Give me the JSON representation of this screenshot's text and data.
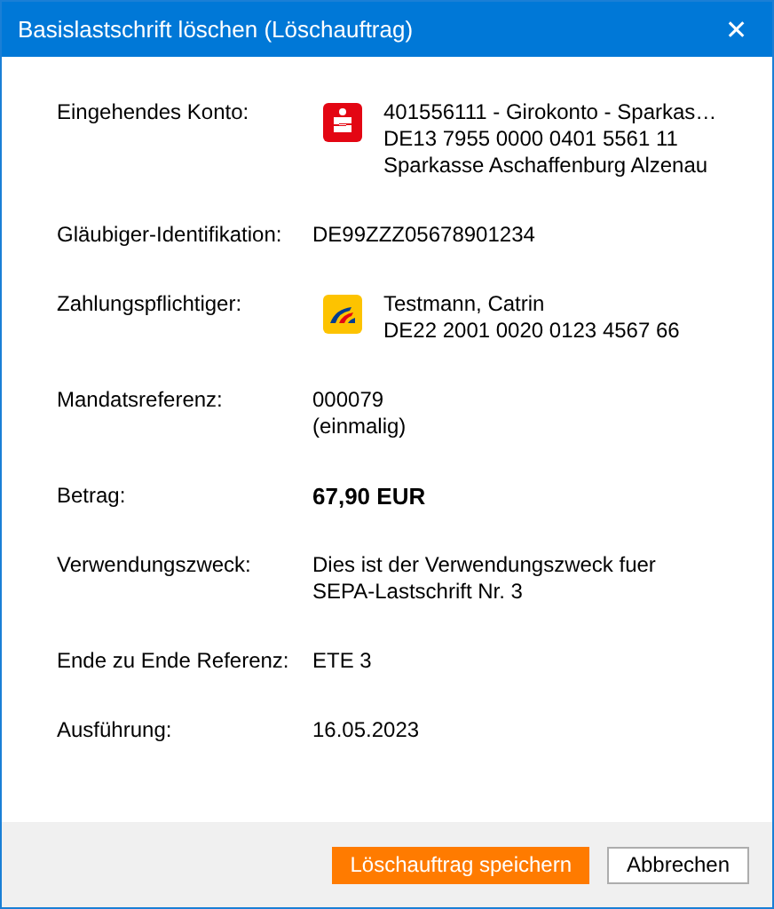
{
  "window": {
    "title": "Basislastschrift löschen (Löschauftrag)",
    "close": "✕"
  },
  "rows": [
    {
      "kind": "icon",
      "label": "Eingehendes Konto:",
      "lines": [
        "401556111 - Girokonto - Sparkas…",
        "DE13 7955 0000 0401 5561 11",
        "Sparkasse Aschaffenburg Alzenau"
      ]
    },
    {
      "kind": "text",
      "label": "Gläubiger-Identifikation:",
      "lines": [
        "DE99ZZZ05678901234"
      ]
    },
    {
      "kind": "icon",
      "label": "Zahlungspflichtiger:",
      "lines": [
        "Testmann, Catrin",
        "DE22 2001 0020 0123 4567 66"
      ]
    },
    {
      "kind": "text",
      "label": "Mandatsreferenz:",
      "lines": [
        "000079",
        "(einmalig)"
      ]
    },
    {
      "kind": "bold",
      "label": "Betrag:",
      "lines": [
        "67,90 EUR"
      ]
    },
    {
      "kind": "text",
      "label": "Verwendungszweck:",
      "lines": [
        "Dies ist der Verwendungszweck fuer",
        "SEPA-Lastschrift Nr. 3"
      ]
    },
    {
      "kind": "text",
      "label": "Ende zu Ende Referenz:",
      "lines": [
        "ETE 3"
      ]
    },
    {
      "kind": "text",
      "label": "Ausführung:",
      "lines": [
        "16.05.2023"
      ]
    }
  ],
  "buttons": [
    {
      "label": "Löschauftrag speichern",
      "kind": "primary"
    },
    {
      "label": "Abbrechen",
      "kind": "secondary"
    }
  ]
}
